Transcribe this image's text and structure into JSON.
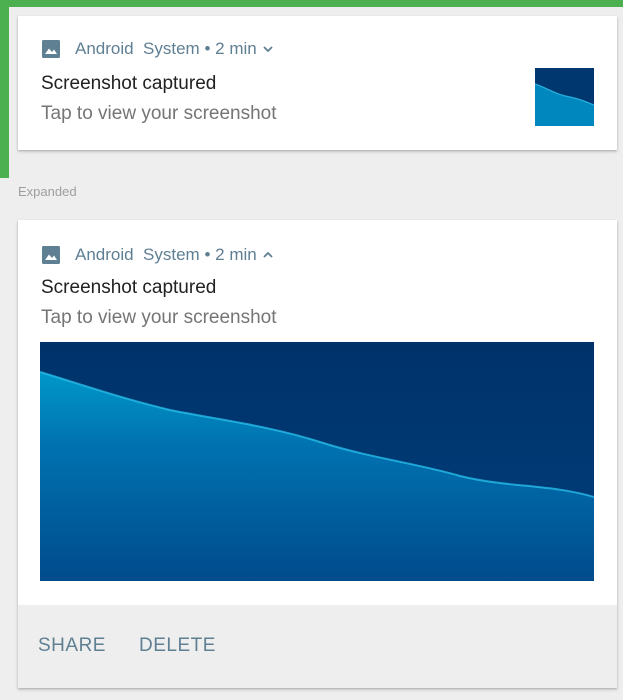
{
  "notification_collapsed": {
    "app_name": "Android  System",
    "separator": " • ",
    "time": "2 min",
    "title": "Screenshot captured",
    "subtitle": "Tap to view your screenshot"
  },
  "section_label": "Expanded",
  "notification_expanded": {
    "app_name": "Android  System",
    "separator": " • ",
    "time": "2 min",
    "title": "Screenshot captured",
    "subtitle": "Tap to view your screenshot",
    "actions": {
      "share_label": "SHARE",
      "delete_label": "DELETE"
    }
  },
  "icons": {
    "app_icon": "image-icon",
    "collapsed_chevron": "chevron-down-icon",
    "expanded_chevron": "chevron-up-icon"
  },
  "colors": {
    "accent_frame": "#4caf50",
    "header_text": "#5f7f93",
    "image_dark": "#00376e",
    "image_wave": "#0099c8"
  }
}
